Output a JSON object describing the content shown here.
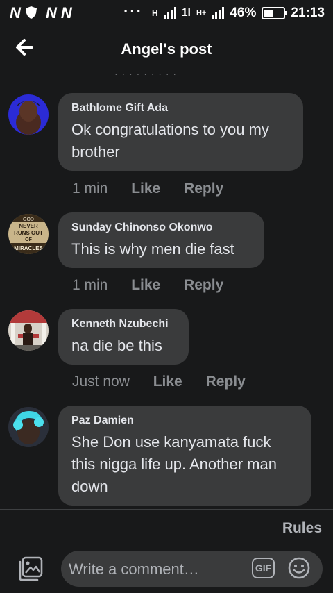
{
  "status_bar": {
    "left_icons": [
      "N",
      "N",
      "N"
    ],
    "dots": "···",
    "network_1": "H",
    "network_2": "1l",
    "network_3": "H+",
    "battery_percent": "46%",
    "battery_level": 0.46,
    "time": "21:13"
  },
  "header": {
    "title": "Angel's post",
    "faded_row": "· · · · · · · · ·"
  },
  "comments": [
    {
      "author": "Bathlome Gift Ada",
      "text": "Ok congratulations to you my brother",
      "time": "1 min",
      "like": "Like",
      "reply": "Reply"
    },
    {
      "author": "Sunday Chinonso Okonwo",
      "text": "This is why men die fast",
      "avatar_text": [
        "GOD",
        "NEVER",
        "RUNS OUT",
        "OF",
        "MIRACLES"
      ],
      "time": "1 min",
      "like": "Like",
      "reply": "Reply"
    },
    {
      "author": "Kenneth Nzubechi",
      "text": "na die be this",
      "time": "Just now",
      "like": "Like",
      "reply": "Reply"
    },
    {
      "author": "Paz Damien",
      "text": "She Don use kanyamata fuck this nigga life up. Another man down"
    }
  ],
  "footer": {
    "rules": "Rules",
    "placeholder": "Write a comment…",
    "gif": "GIF"
  },
  "icons": {
    "back": "arrow-left-icon",
    "photo": "photo-icon",
    "gif": "gif-icon",
    "emoji": "emoji-icon"
  },
  "colors": {
    "background": "#18191a",
    "bubble": "#3a3b3c",
    "text": "#e4e6eb",
    "secondary_text": "#8a8d91"
  }
}
